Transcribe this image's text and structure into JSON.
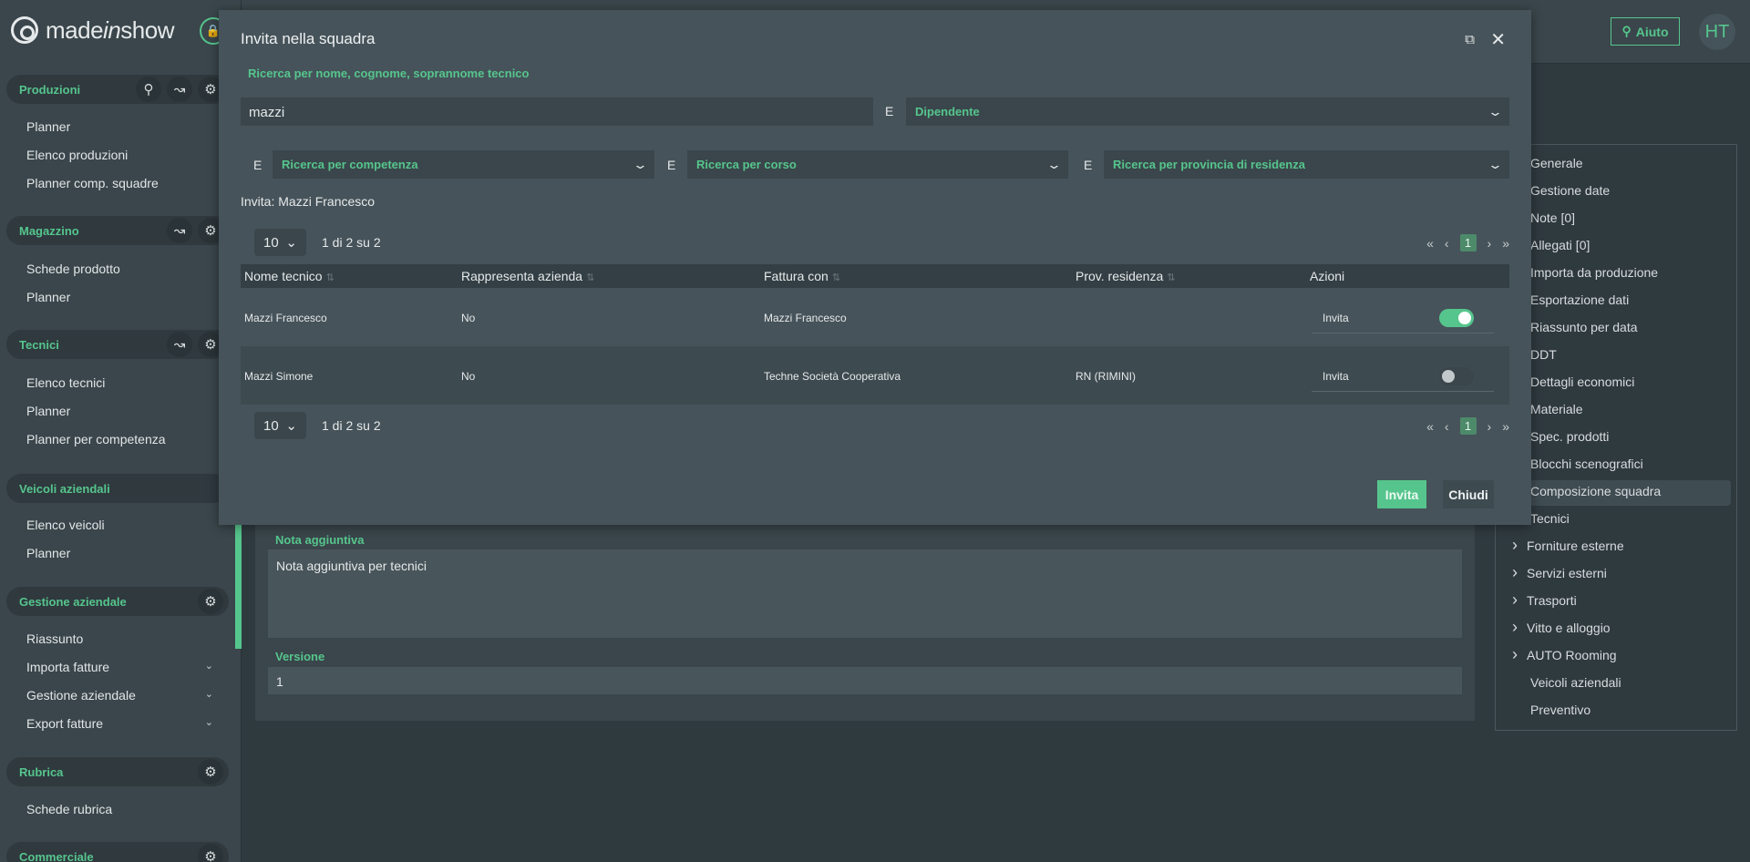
{
  "brand": {
    "name_a": "made",
    "name_b": "in",
    "name_c": "show"
  },
  "header": {
    "help_label": "Aiuto",
    "avatar_initials": "HT"
  },
  "sidebar": {
    "sections": [
      {
        "title": "Produzioni",
        "items": [
          "Planner",
          "Elenco produzioni",
          "Planner comp. squadre"
        ]
      },
      {
        "title": "Magazzino",
        "items": [
          "Schede prodotto",
          "Planner"
        ]
      },
      {
        "title": "Tecnici",
        "items": [
          "Elenco tecnici",
          "Planner",
          "Planner per competenza"
        ]
      },
      {
        "title": "Veicoli aziendali",
        "items": [
          "Elenco veicoli",
          "Planner"
        ]
      },
      {
        "title": "Gestione aziendale",
        "items": [
          "Riassunto",
          "Importa fatture",
          "Gestione aziendale",
          "Export fatture"
        ]
      },
      {
        "title": "Rubrica",
        "items": [
          "Schede rubrica"
        ]
      },
      {
        "title": "Commerciale",
        "items": []
      }
    ]
  },
  "form": {
    "note_label": "Nota aggiuntiva",
    "note_value": "Nota aggiuntiva per tecnici",
    "version_label": "Versione",
    "version_value": "1"
  },
  "section_nav": [
    "Generale",
    "Gestione date",
    "Note [0]",
    "Allegati [0]",
    "Importa da produzione",
    "Esportazione dati",
    "Riassunto per data",
    "DDT",
    "Dettagli economici",
    "Materiale",
    "Spec. prodotti",
    "Blocchi scenografici",
    "Composizione squadra",
    "Tecnici",
    "Forniture esterne",
    "Servizi esterni",
    "Trasporti",
    "Vitto e alloggio",
    "AUTO Rooming",
    "Veicoli aziendali",
    "Preventivo"
  ],
  "modal": {
    "title": "Invita nella squadra",
    "search_label": "Ricerca per nome, cognome, soprannome tecnico",
    "search_value": "mazzi",
    "connector": "E",
    "type_select": "Dipendente",
    "skill_select": "Ricerca per competenza",
    "course_select": "Ricerca per corso",
    "province_select": "Ricerca per provincia di residenza",
    "invite_text": "Invita: Mazzi Francesco",
    "page_size": "10",
    "page_info": "1 di 2 su 2",
    "current_page": "1",
    "columns": [
      "Nome tecnico",
      "Rappresenta azienda",
      "Fattura con",
      "Prov. residenza",
      "Azioni"
    ],
    "rows": [
      {
        "name": "Mazzi Francesco",
        "represents": "No",
        "invoice": "Mazzi Francesco",
        "province": "",
        "action": "Invita",
        "invited": true
      },
      {
        "name": "Mazzi Simone",
        "represents": "No",
        "invoice": "Techne Società Cooperativa",
        "province": "RN (RIMINI)",
        "action": "Invita",
        "invited": false
      }
    ],
    "invite_button": "Invita",
    "close_button": "Chiudi"
  }
}
